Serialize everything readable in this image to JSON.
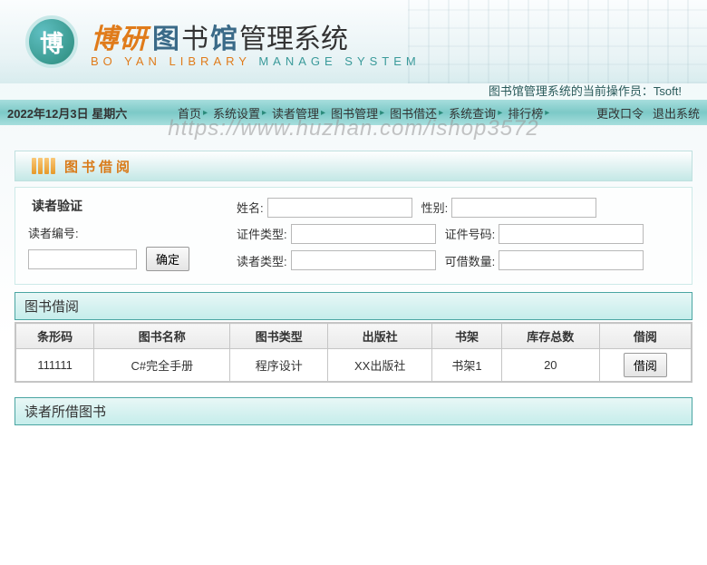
{
  "header": {
    "logo_char": "博",
    "title_orange": "博研",
    "title_blue_1": "图",
    "title_black_1": "书",
    "title_blue_2": "馆",
    "title_suffix": "管理系统",
    "subtitle_en_1": "BO YAN LIBRARY",
    "subtitle_en_2": "MANAGE SYSTEM",
    "operator_text": "图书馆管理系统的当前操作员：Tsoft!"
  },
  "nav": {
    "date": "2022年12月3日 星期六",
    "items": [
      "首页",
      "系统设置",
      "读者管理",
      "图书管理",
      "图书借还",
      "系统查询",
      "排行榜"
    ],
    "right": {
      "change_pw": "更改口令",
      "logout": "退出系统"
    }
  },
  "watermark": "https://www.huzhan.com/ishop3572",
  "sections": {
    "borrow_title": "图书借阅",
    "reader_verify": "读者验证",
    "reader_id_label": "读者编号:",
    "confirm_btn": "确定",
    "fields": {
      "name": "姓名:",
      "gender": "性别:",
      "id_type": "证件类型:",
      "id_no": "证件号码:",
      "reader_type": "读者类型:",
      "borrow_limit": "可借数量:"
    },
    "table_header": "图书借阅",
    "columns": [
      "条形码",
      "图书名称",
      "图书类型",
      "出版社",
      "书架",
      "库存总数",
      "借阅"
    ],
    "rows": [
      {
        "barcode": "111111",
        "name": "C#完全手册",
        "type": "程序设计",
        "publisher": "XX出版社",
        "shelf": "书架1",
        "stock": "20",
        "action": "借阅"
      }
    ],
    "borrowed_header": "读者所借图书"
  }
}
